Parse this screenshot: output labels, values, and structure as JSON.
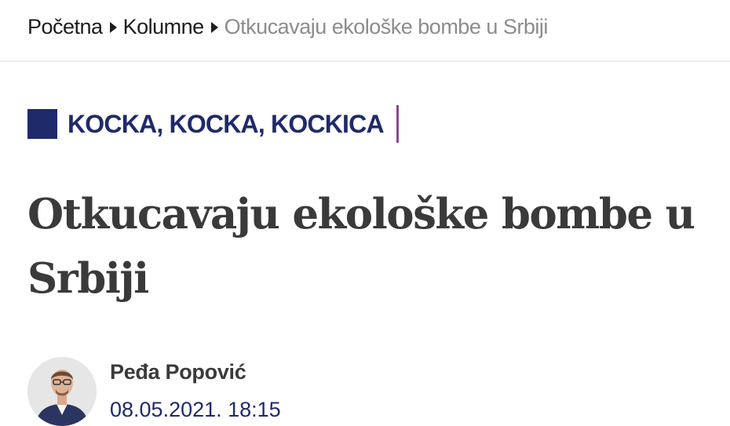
{
  "breadcrumb": {
    "home": "Početna",
    "section": "Kolumne",
    "current": "Otkucavaju ekološke bombe u Srbiji"
  },
  "category": {
    "label": "KOCKA, KOCKA, KOCKICA",
    "accent_color": "#1f2a6b",
    "bar_color": "#8e4595"
  },
  "article": {
    "title": "Otkucavaju ekološke bombe u Srbiji",
    "author": "Peđa Popović",
    "date": "08.05.2021. 18:15"
  }
}
